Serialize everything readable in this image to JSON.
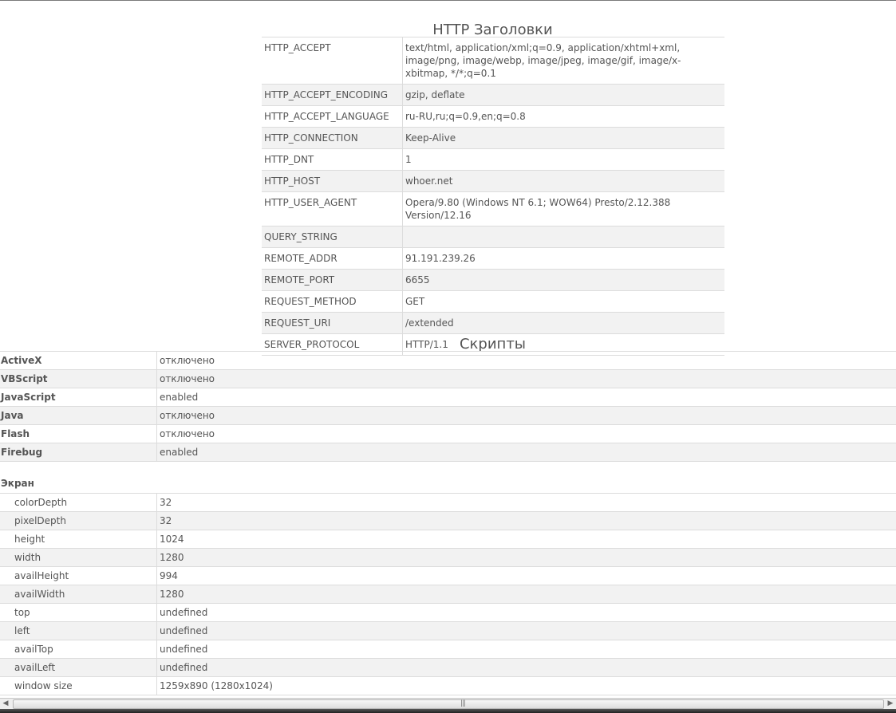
{
  "http_section": {
    "title": "HTTP Заголовки",
    "rows": [
      {
        "key": "HTTP_ACCEPT",
        "value": "text/html, application/xml;q=0.9, application/xhtml+xml, image/png, image/webp, image/jpeg, image/gif, image/x-xbitmap, */*;q=0.1"
      },
      {
        "key": "HTTP_ACCEPT_ENCODING",
        "value": "gzip, deflate"
      },
      {
        "key": "HTTP_ACCEPT_LANGUAGE",
        "value": "ru-RU,ru;q=0.9,en;q=0.8"
      },
      {
        "key": "HTTP_CONNECTION",
        "value": "Keep-Alive"
      },
      {
        "key": "HTTP_DNT",
        "value": "1"
      },
      {
        "key": "HTTP_HOST",
        "value": "whoer.net"
      },
      {
        "key": "HTTP_USER_AGENT",
        "value": "Opera/9.80 (Windows NT 6.1; WOW64) Presto/2.12.388 Version/12.16"
      },
      {
        "key": "QUERY_STRING",
        "value": ""
      },
      {
        "key": "REMOTE_ADDR",
        "value": "91.191.239.26"
      },
      {
        "key": "REMOTE_PORT",
        "value": "6655"
      },
      {
        "key": "REQUEST_METHOD",
        "value": "GET"
      },
      {
        "key": "REQUEST_URI",
        "value": "/extended"
      },
      {
        "key": "SERVER_PROTOCOL",
        "value": "HTTP/1.1"
      }
    ]
  },
  "scripts_section": {
    "title": "Скрипты",
    "rows": [
      {
        "key": "ActiveX",
        "value": "отключено"
      },
      {
        "key": "VBScript",
        "value": "отключено"
      },
      {
        "key": "JavaScript",
        "value": "enabled"
      },
      {
        "key": "Java",
        "value": "отключено"
      },
      {
        "key": "Flash",
        "value": "отключено"
      },
      {
        "key": "Firebug",
        "value": "enabled"
      }
    ],
    "screen_heading": "Экран",
    "screen_rows": [
      {
        "key": "colorDepth",
        "value": "32"
      },
      {
        "key": "pixelDepth",
        "value": "32"
      },
      {
        "key": "height",
        "value": "1024"
      },
      {
        "key": "width",
        "value": "1280"
      },
      {
        "key": "availHeight",
        "value": "994"
      },
      {
        "key": "availWidth",
        "value": "1280"
      },
      {
        "key": "top",
        "value": "undefined"
      },
      {
        "key": "left",
        "value": "undefined"
      },
      {
        "key": "availTop",
        "value": "undefined"
      },
      {
        "key": "availLeft",
        "value": "undefined"
      },
      {
        "key": "window size",
        "value": "1259x890 (1280x1024)"
      }
    ]
  },
  "scrollbar": {
    "left_arrow": "◀",
    "right_arrow": "▶",
    "grip": "|||"
  }
}
